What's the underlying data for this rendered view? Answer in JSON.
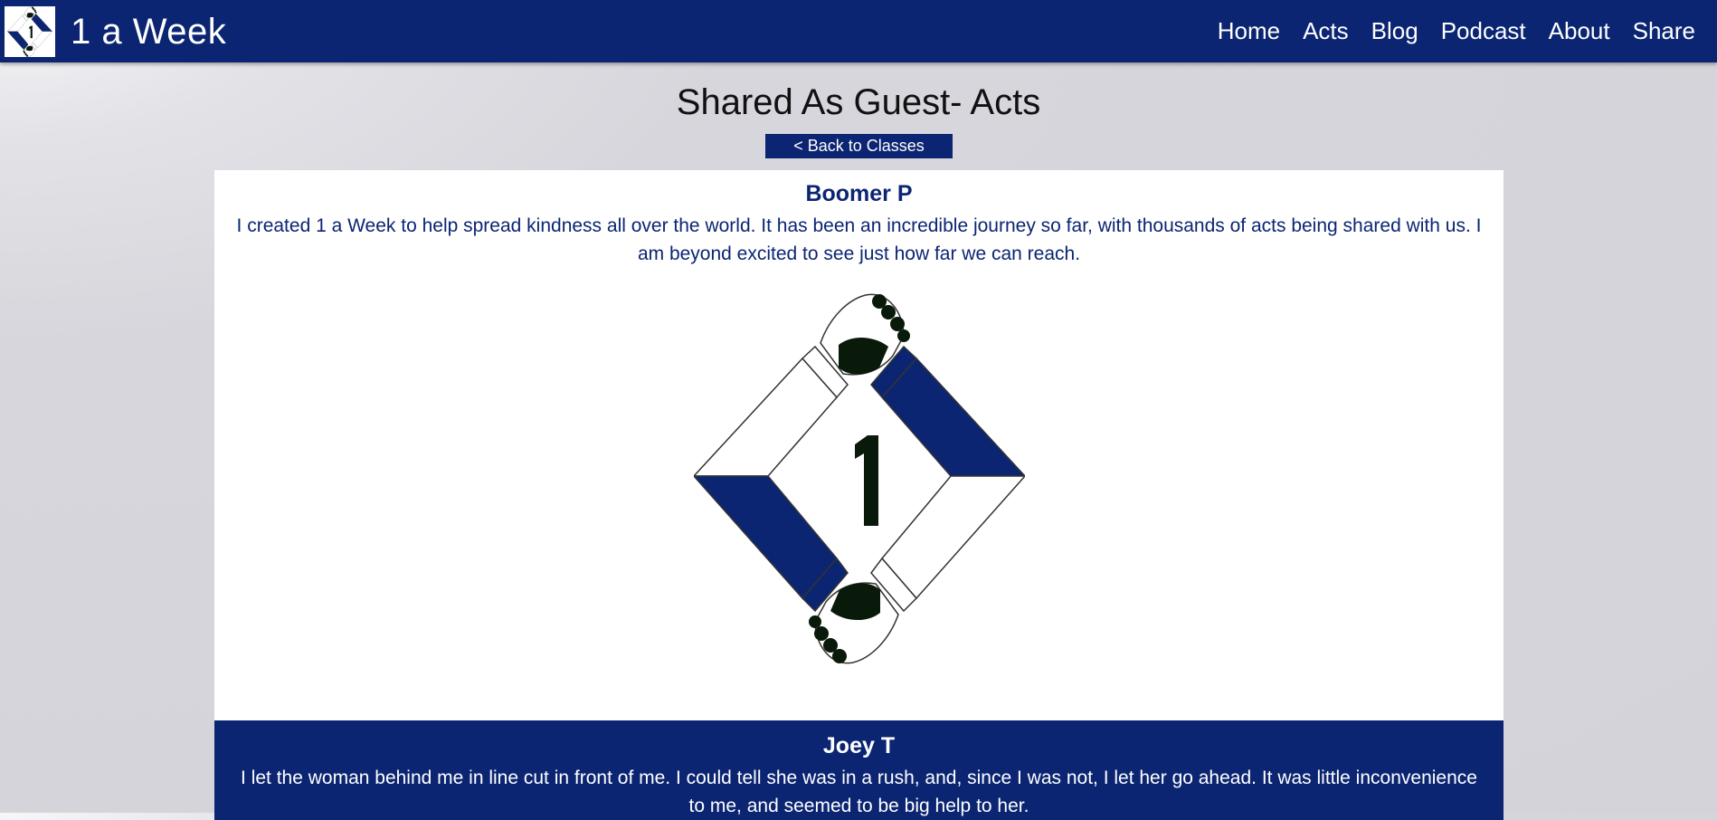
{
  "brand": {
    "name": "1 a Week",
    "logo_icon": "handshake-diamond-logo-icon"
  },
  "nav": {
    "items": [
      {
        "label": "Home"
      },
      {
        "label": "Acts"
      },
      {
        "label": "Blog"
      },
      {
        "label": "Podcast"
      },
      {
        "label": "About"
      },
      {
        "label": "Share"
      }
    ]
  },
  "page": {
    "title": "Shared As Guest- Acts",
    "back_button": "< Back to Classes"
  },
  "acts": [
    {
      "name": "Boomer P",
      "text": "I created 1 a Week to help spread kindness all over the world. It has been an incredible journey so far, with thousands of acts being shared with us. I am beyond excited to see just how far we can reach.",
      "image_icon": "handshake-diamond-logo-icon"
    },
    {
      "name": "Joey T",
      "text": "I let the woman behind me in line cut in front of me. I could tell she was in a rush, and, since I was not, I let her go ahead. It was little inconvenience to me, and seemed to be big help to her."
    }
  ],
  "colors": {
    "brand_navy": "#0b2572",
    "hand_dark": "#0a1a0a",
    "card_white": "#ffffff"
  }
}
